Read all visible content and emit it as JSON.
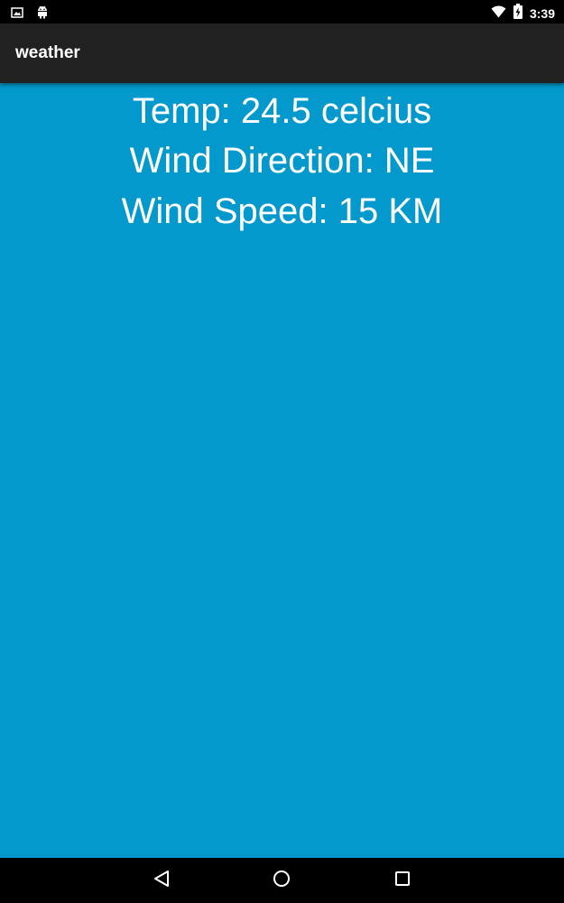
{
  "status_bar": {
    "time": "3:39",
    "icons": [
      "image-icon",
      "android-icon",
      "wifi-icon",
      "battery-charging-icon"
    ]
  },
  "app_bar": {
    "title": "weather"
  },
  "weather": {
    "temp": "Temp: 24.5 celcius",
    "wind_direction": "Wind Direction: NE",
    "wind_speed": "Wind Speed: 15 KM"
  },
  "nav_bar": {
    "icons": [
      "back-icon",
      "home-icon",
      "recents-icon"
    ]
  },
  "colors": {
    "content_background": "#0399cc",
    "app_bar": "#212121",
    "system_bars": "#000000",
    "text": "#ffffff"
  }
}
